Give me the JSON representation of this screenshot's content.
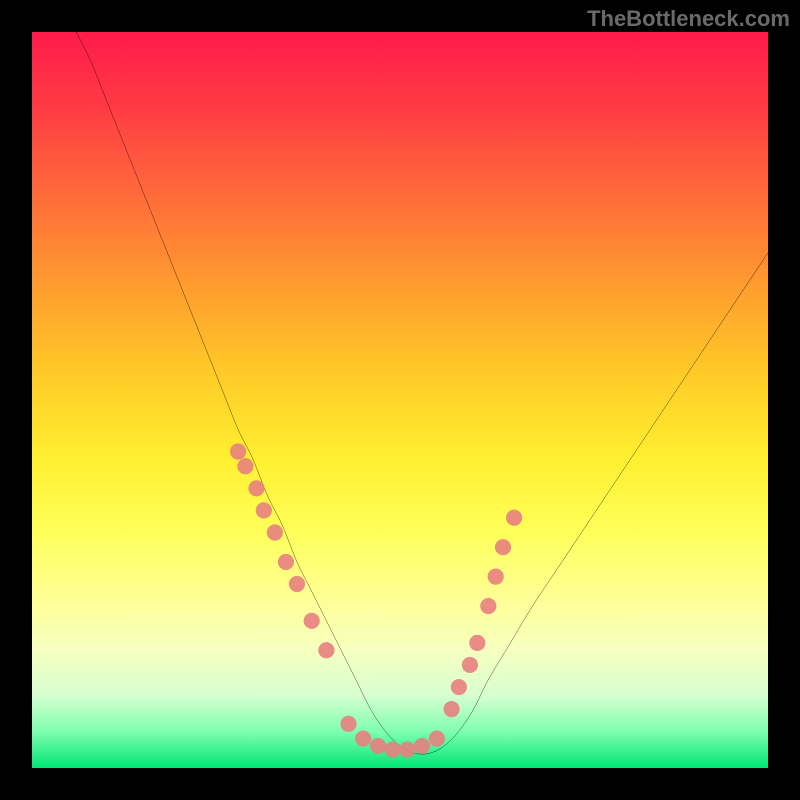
{
  "watermark": "TheBottleneck.com",
  "chart_data": {
    "type": "line",
    "title": "",
    "xlabel": "",
    "ylabel": "",
    "xlim": [
      0,
      100
    ],
    "ylim": [
      0,
      100
    ],
    "grid": false,
    "series": [
      {
        "name": "curve",
        "x": [
          6,
          8,
          10,
          12,
          14,
          16,
          18,
          20,
          22,
          24,
          26,
          28,
          30,
          32,
          34,
          36,
          38,
          40,
          42,
          44,
          46,
          48,
          50,
          52,
          54,
          56,
          58,
          60,
          62,
          65,
          68,
          72,
          76,
          80,
          84,
          88,
          92,
          96,
          100
        ],
        "y": [
          100,
          96,
          91,
          86,
          81,
          76,
          71,
          66,
          61,
          56,
          51,
          46,
          42,
          37,
          33,
          28,
          24,
          20,
          16,
          12,
          8,
          5,
          3,
          2,
          2,
          3,
          5,
          8,
          12,
          17,
          22,
          28,
          34,
          40,
          46,
          52,
          58,
          64,
          70
        ]
      }
    ],
    "scatter_series": [
      {
        "name": "dots-left",
        "color": "#e88080",
        "x": [
          28,
          29,
          30.5,
          31.5,
          33,
          34.5,
          36,
          38,
          40
        ],
        "y": [
          43,
          41,
          38,
          35,
          32,
          28,
          25,
          20,
          16
        ]
      },
      {
        "name": "dots-bottom",
        "color": "#e88080",
        "x": [
          43,
          45,
          47,
          49,
          51,
          53,
          55
        ],
        "y": [
          6,
          4,
          3,
          2.5,
          2.5,
          3,
          4
        ]
      },
      {
        "name": "dots-right",
        "color": "#e88080",
        "x": [
          57,
          58,
          59.5,
          60.5,
          62,
          63,
          64,
          65.5
        ],
        "y": [
          8,
          11,
          14,
          17,
          22,
          26,
          30,
          34
        ]
      }
    ]
  }
}
